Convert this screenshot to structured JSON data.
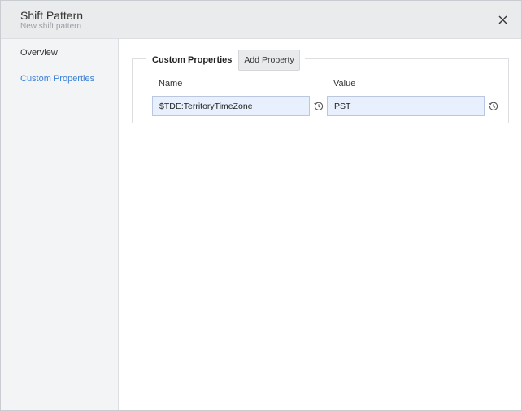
{
  "dialog": {
    "title": "Shift Pattern",
    "subtitle": "New shift pattern",
    "close_icon": "close-icon"
  },
  "sidebar": {
    "items": [
      {
        "label": "Overview",
        "active": false
      },
      {
        "label": "Custom Properties",
        "active": true
      }
    ]
  },
  "custom_properties": {
    "legend": "Custom Properties",
    "add_button": "Add Property",
    "columns": {
      "name": "Name",
      "value": "Value"
    },
    "rows": [
      {
        "name": "$TDE:TerritoryTimeZone",
        "value": "PST"
      }
    ]
  },
  "colors": {
    "accent": "#3b7fd6",
    "header_bg": "#eaebed",
    "sidebar_bg": "#f3f4f6",
    "input_bg": "#e8f0fe"
  }
}
